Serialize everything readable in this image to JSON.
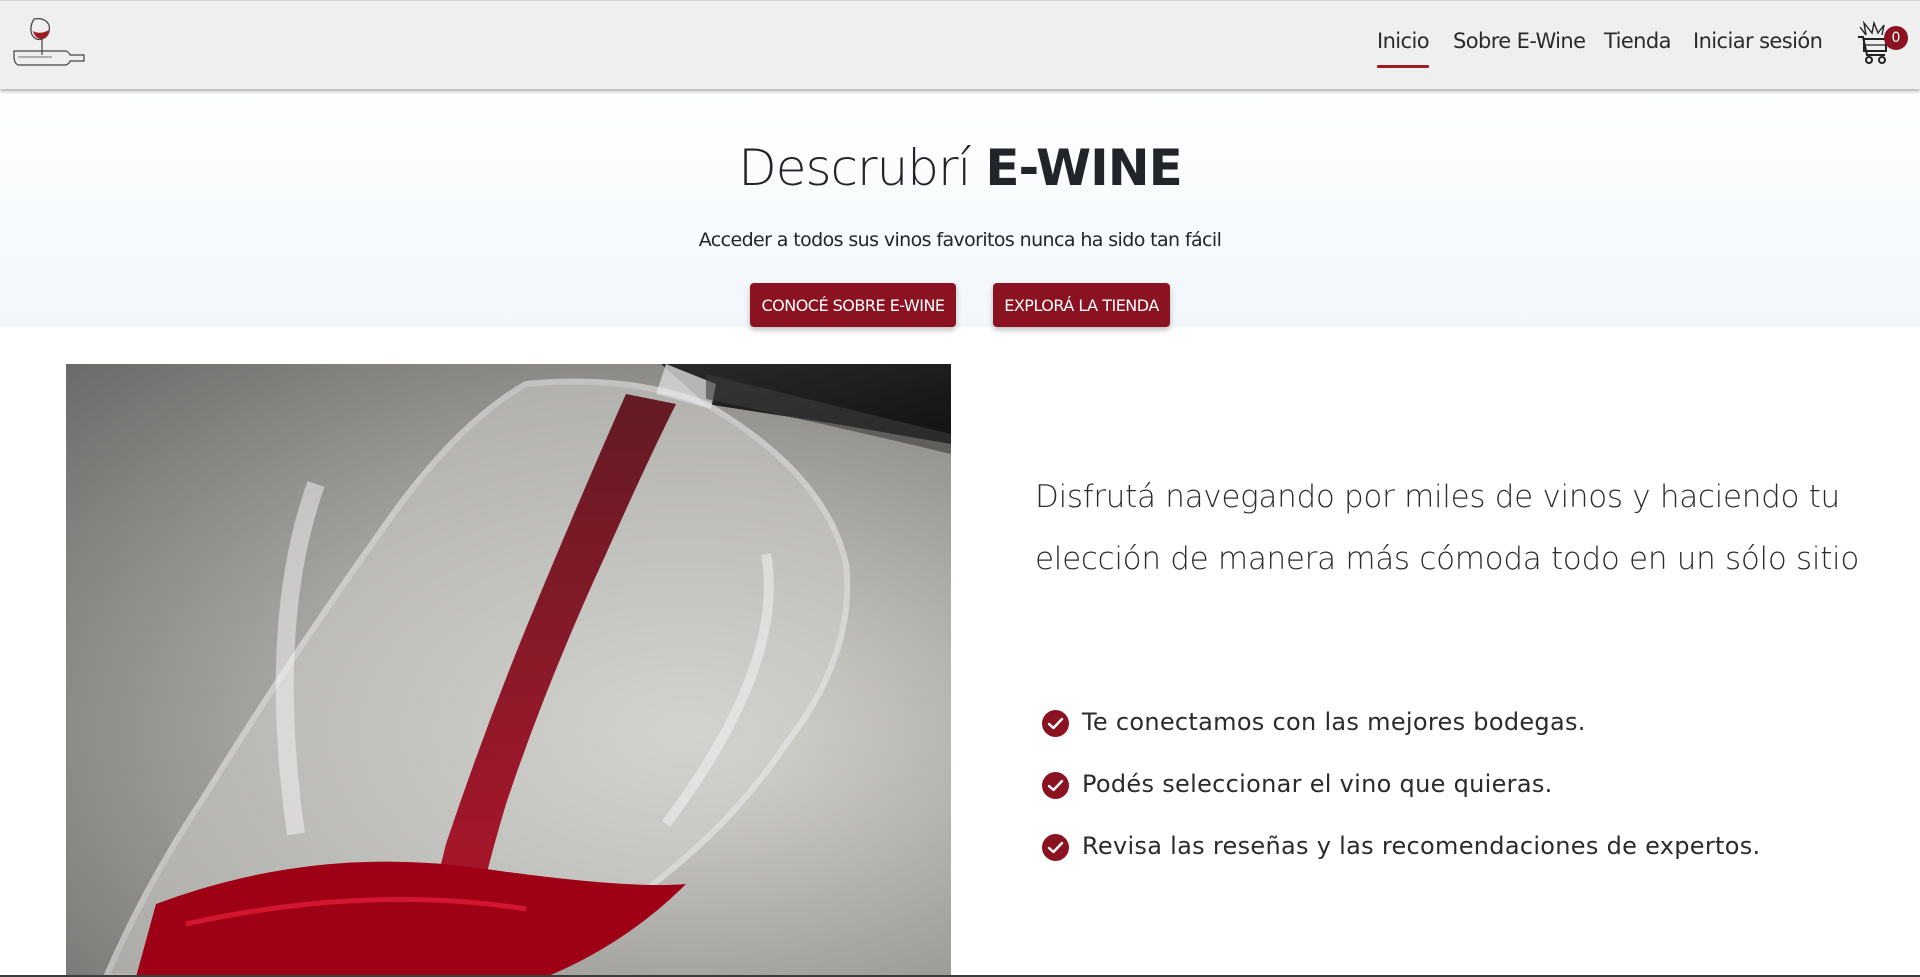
{
  "nav": {
    "logo_icon": "wine-glass-bottle-logo",
    "links": [
      {
        "label": "Inicio",
        "active": true
      },
      {
        "label": "Sobre E-Wine",
        "active": false
      },
      {
        "label": "Tienda",
        "active": false
      },
      {
        "label": "Iniciar sesión",
        "active": false
      }
    ],
    "cart": {
      "icon": "shopping-cart-icon",
      "count": "0"
    }
  },
  "hero": {
    "title_prefix": "Descrubrí",
    "title_brand": "E-WINE",
    "subtitle": "Acceder a todos sus vinos favoritos nunca ha sido tan fácil",
    "buttons": {
      "about": "CONOCÉ SOBRE E-WINE",
      "shop": "EXPLORÁ LA TIENDA"
    }
  },
  "main": {
    "image_icon": "wine-pouring-photo",
    "tagline": "Disfrutá navegando por miles de vinos y haciendo tu elección de manera más cómoda todo en un sólo sitio",
    "features": [
      "Te conectamos con las mejores bodegas.",
      "Podés seleccionar el vino que quieras.",
      "Revisa las reseñas y las recomendaciones de expertos."
    ]
  },
  "colors": {
    "accent": "#8b1220",
    "navbar_bg": "#efefef",
    "text": "#212529"
  }
}
